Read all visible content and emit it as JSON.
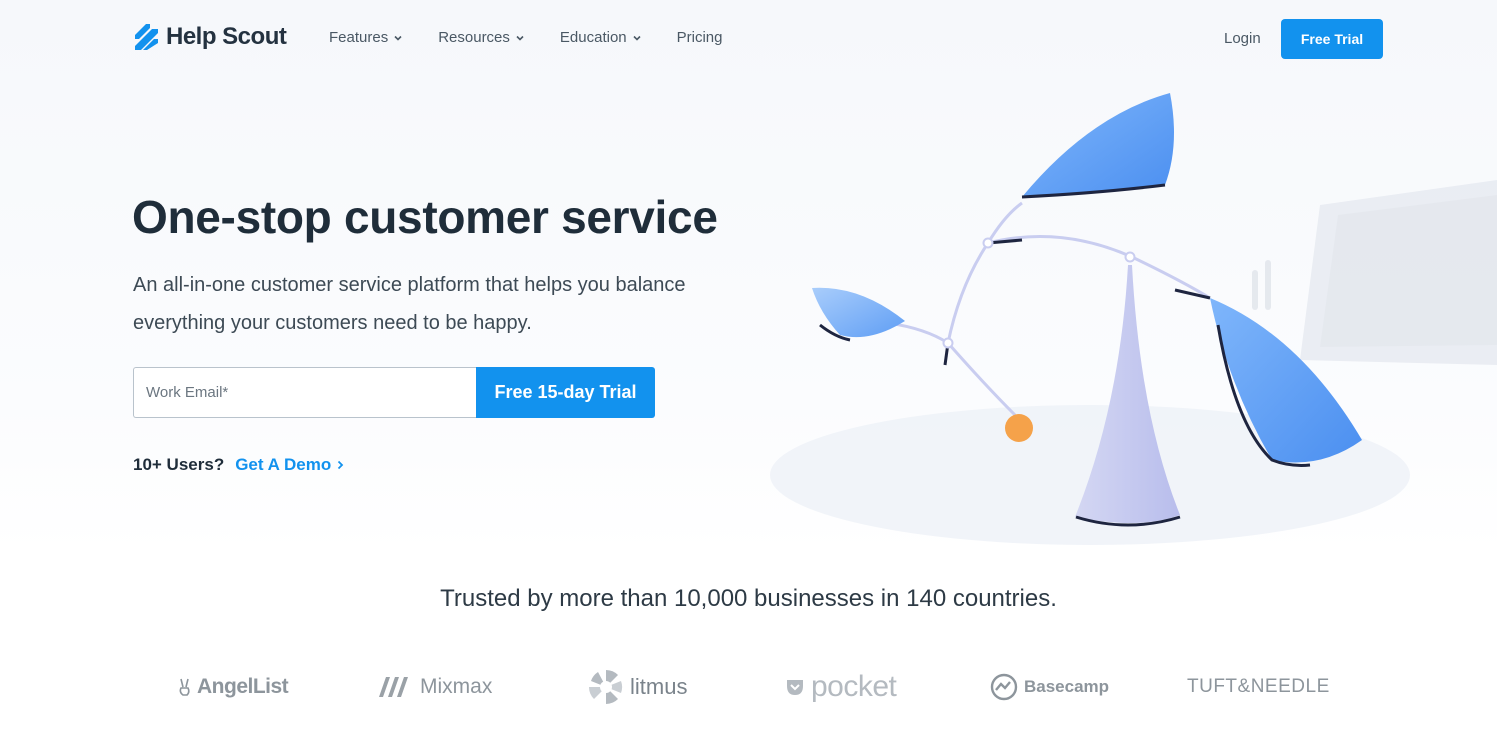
{
  "brand": {
    "name": "Help Scout",
    "accent": "#1292ee",
    "logo_color": "#1292ee"
  },
  "nav": {
    "items": [
      {
        "label": "Features",
        "has_dropdown": true
      },
      {
        "label": "Resources",
        "has_dropdown": true
      },
      {
        "label": "Education",
        "has_dropdown": true
      },
      {
        "label": "Pricing",
        "has_dropdown": false
      }
    ],
    "login_label": "Login",
    "cta_label": "Free Trial"
  },
  "hero": {
    "title": "One-stop customer service",
    "subtitle": "An all-in-one customer service platform that helps you balance everything your customers need to be happy.",
    "email_placeholder": "Work Email*",
    "cta_label": "Free 15-day Trial",
    "demo_question": "10+ Users?",
    "demo_link": "Get A Demo"
  },
  "trust": {
    "headline": "Trusted by more than 10,000 businesses in 140 countries.",
    "logos": [
      {
        "name": "AngelList",
        "icon": "victory-hand-icon"
      },
      {
        "name": "Mixmax",
        "icon": "mixmax-m-icon"
      },
      {
        "name": "litmus",
        "icon": "litmus-wheel-icon"
      },
      {
        "name": "pocket",
        "icon": "pocket-icon"
      },
      {
        "name": "Basecamp",
        "icon": "basecamp-icon"
      },
      {
        "name": "TUFT&NEEDLE",
        "icon": ""
      }
    ]
  },
  "colors": {
    "text_dark": "#1f2d3a",
    "text_body": "#3d4a55",
    "link_blue": "#1292ee",
    "logo_gray": "#8d959c",
    "illustration_blue": "#5aa5f5",
    "illustration_lavender": "#c5c9f0",
    "ball_orange": "#f5a24a"
  }
}
